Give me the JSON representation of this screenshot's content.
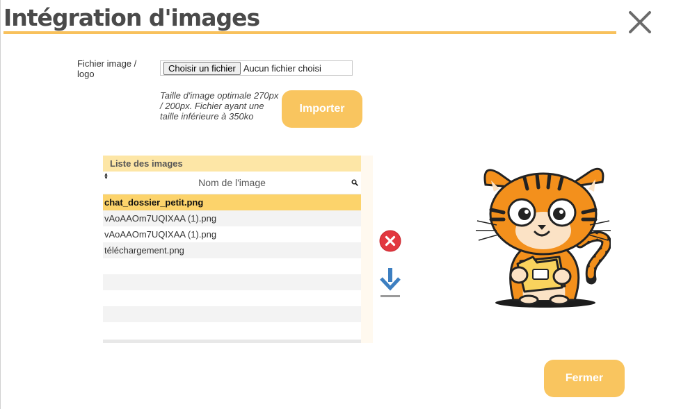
{
  "dialog": {
    "title": "Intégration d'images"
  },
  "upload": {
    "label": "Fichier image / logo",
    "choose_button": "Choisir un fichier",
    "file_status": "Aucun fichier choisi",
    "hint": "Taille d'image optimale 270px / 200px. Fichier ayant une taille inférieure à 350ko",
    "import_button": "Importer"
  },
  "image_list": {
    "title": "Liste des images",
    "column_header": "Nom de l'image",
    "rows": [
      {
        "name": "chat_dossier_petit.png",
        "selected": true
      },
      {
        "name": "vAoAAOm7UQIXAA (1).png",
        "selected": false
      },
      {
        "name": "vAoAAOm7UQIXAA (1).png",
        "selected": false
      },
      {
        "name": "téléchargement.png",
        "selected": false
      },
      {
        "name": "",
        "selected": false
      },
      {
        "name": "",
        "selected": false
      },
      {
        "name": "",
        "selected": false
      },
      {
        "name": "",
        "selected": false
      },
      {
        "name": "",
        "selected": false
      }
    ]
  },
  "footer": {
    "close_button": "Fermer"
  },
  "colors": {
    "accent": "#f9c55f",
    "selected_row": "#fcd36b",
    "delete_red": "#e2373f",
    "download_blue": "#3d7fc1"
  },
  "icons": {
    "close": "close-icon",
    "delete": "delete-icon",
    "download": "download-icon",
    "search": "search-icon",
    "sort": "sort-icon"
  }
}
